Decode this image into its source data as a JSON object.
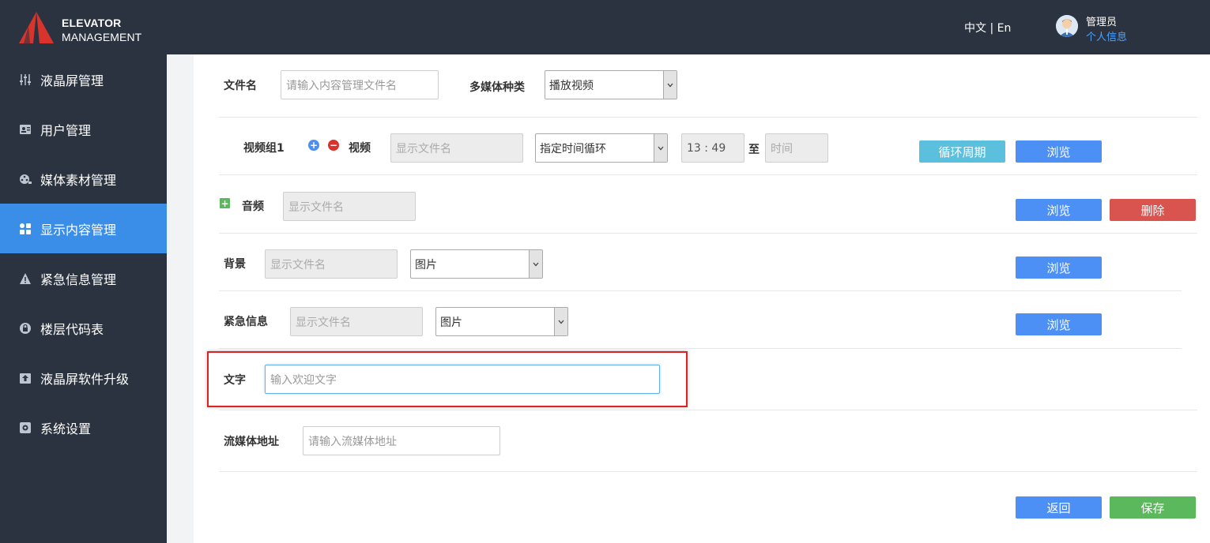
{
  "header": {
    "brand_line1": "ELEVATOR",
    "brand_line2": "MANAGEMENT",
    "lang_switch": "中文 | En",
    "user_name": "管理员",
    "user_info_link": "个人信息",
    "bg_color": "#2c3340",
    "accent_red": "#d9342b"
  },
  "sidebar": {
    "active_color": "#3b8ee8",
    "items": [
      {
        "label": "液晶屏管理",
        "icon": "sliders-icon"
      },
      {
        "label": "用户管理",
        "icon": "user-card-icon"
      },
      {
        "label": "媒体素材管理",
        "icon": "media-reel-icon"
      },
      {
        "label": "显示内容管理",
        "icon": "grid-icon",
        "active": true
      },
      {
        "label": "紧急信息管理",
        "icon": "warning-icon"
      },
      {
        "label": "楼层代码表",
        "icon": "lock-icon"
      },
      {
        "label": "液晶屏软件升级",
        "icon": "upload-icon"
      },
      {
        "label": "系统设置",
        "icon": "gear-icon"
      }
    ]
  },
  "form": {
    "filename": {
      "label": "文件名",
      "placeholder": "请输入内容管理文件名"
    },
    "media_type": {
      "label": "多媒体种类",
      "value": "播放视频"
    },
    "video_group": {
      "label": "视频组1",
      "add_icon": "plus-circle-icon",
      "remove_icon": "minus-circle-icon",
      "video_label": "视频",
      "file_placeholder": "显示文件名",
      "loop_mode": "指定时间循环",
      "start_time": "13 : 49",
      "to_label": "至",
      "end_time_placeholder": "时间",
      "cycle_button": "循环周期",
      "browse_button": "浏览"
    },
    "audio": {
      "add_icon": "plus-square-icon",
      "label": "音频",
      "file_placeholder": "显示文件名",
      "browse_button": "浏览",
      "delete_button": "删除"
    },
    "background": {
      "label": "背景",
      "file_placeholder": "显示文件名",
      "type": "图片",
      "browse_button": "浏览"
    },
    "emergency": {
      "label": "紧急信息",
      "file_placeholder": "显示文件名",
      "type": "图片",
      "browse_button": "浏览"
    },
    "text": {
      "label": "文字",
      "placeholder": "输入欢迎文字"
    },
    "stream": {
      "label": "流媒体地址",
      "placeholder": "请输入流媒体地址"
    },
    "back_button": "返回",
    "save_button": "保存"
  }
}
